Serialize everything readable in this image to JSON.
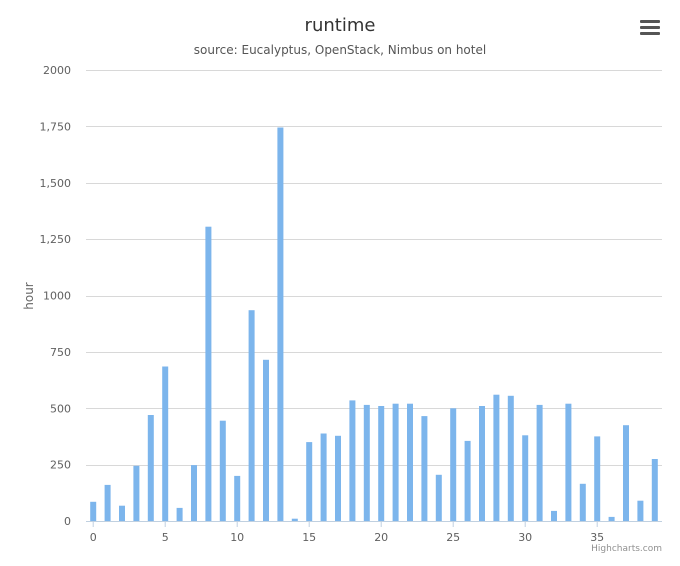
{
  "chart_data": {
    "type": "bar",
    "title": "runtime",
    "subtitle": "source: Eucalyptus, OpenStack, Nimbus on hotel",
    "xlabel": "",
    "ylabel": "hour",
    "ylim": [
      0,
      2000
    ],
    "yticks": [
      0,
      250,
      500,
      750,
      1000,
      1250,
      1500,
      1750,
      2000
    ],
    "ytick_labels": [
      "0",
      "250",
      "500",
      "750",
      "1000",
      "1,250",
      "1,500",
      "1,750",
      "2000"
    ],
    "xticks": [
      0,
      5,
      10,
      15,
      20,
      25,
      30,
      35
    ],
    "x": [
      0,
      1,
      2,
      3,
      4,
      5,
      6,
      7,
      8,
      9,
      10,
      11,
      12,
      13,
      14,
      15,
      16,
      17,
      18,
      19,
      20,
      21,
      22,
      23,
      24,
      25,
      26,
      27,
      28,
      29,
      30,
      31,
      32,
      33,
      34,
      35,
      36,
      37,
      38,
      39
    ],
    "values": [
      85,
      160,
      68,
      245,
      470,
      685,
      58,
      248,
      1305,
      445,
      200,
      935,
      715,
      1745,
      10,
      350,
      388,
      378,
      535,
      515,
      510,
      520,
      520,
      465,
      205,
      500,
      355,
      510,
      560,
      555,
      380,
      515,
      45,
      520,
      165,
      375,
      18,
      425,
      90,
      275
    ],
    "color": "#7cb5ec",
    "grid": true,
    "legend": "none"
  },
  "credits": "Highcharts.com",
  "menu_icon": "hamburger-menu-icon"
}
